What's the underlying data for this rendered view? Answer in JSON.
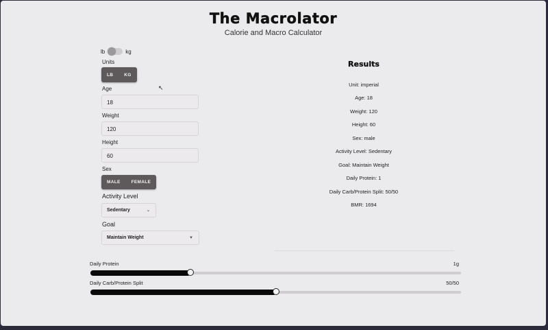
{
  "header": {
    "title": "The Macrolator",
    "subtitle": "Calorie and Macro Calculator"
  },
  "unit_toggle": {
    "left_label": "lb",
    "right_label": "kg",
    "checked": false
  },
  "form": {
    "units": {
      "label": "Units",
      "options": [
        "LB",
        "KG"
      ]
    },
    "age": {
      "label": "Age",
      "value": "18"
    },
    "weight": {
      "label": "Weight",
      "value": "120"
    },
    "height": {
      "label": "Height",
      "value": "60"
    },
    "sex": {
      "label": "Sex",
      "options": [
        "MALE",
        "FEMALE"
      ]
    },
    "activity": {
      "label": "Activity Level",
      "selected": "Sedentary"
    },
    "goal": {
      "label": "Goal",
      "selected": "Maintain Weight"
    }
  },
  "results": {
    "title": "Results",
    "lines": [
      "Unit: imperial",
      "Age: 18",
      "Weight: 120",
      "Height: 60",
      "Sex: male",
      "Activity Level: Sedentary",
      "Goal: Maintain Weight",
      "Daily Protein: 1",
      "Daily Carb/Protein Split: 50/50",
      "BMR: 1694"
    ]
  },
  "sliders": {
    "protein": {
      "label": "Daily Protein",
      "value_text": "1g",
      "fraction": 0.27
    },
    "split": {
      "label": "Daily Carb/Protein Split",
      "value_text": "50/50",
      "fraction": 0.5
    }
  }
}
